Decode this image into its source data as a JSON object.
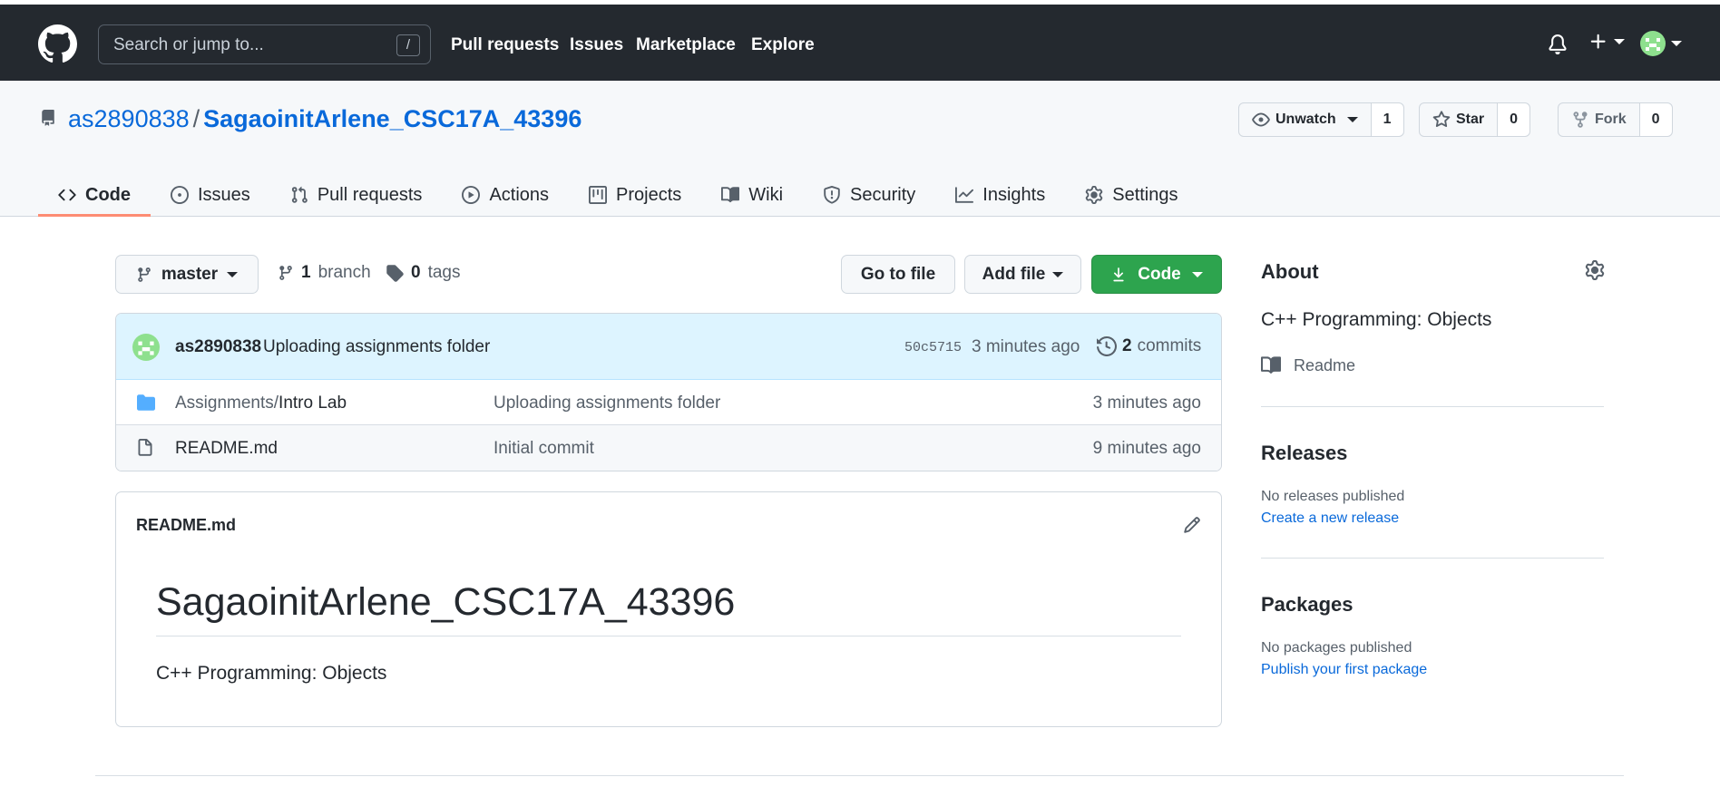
{
  "header": {
    "search_placeholder": "Search or jump to...",
    "search_shortcut": "/",
    "nav": [
      "Pull requests",
      "Issues",
      "Marketplace",
      "Explore"
    ]
  },
  "repo": {
    "owner": "as2890838",
    "separator": "/",
    "name": "SagaoinitArlene_CSC17A_43396",
    "watch_label": "Unwatch",
    "watch_count": "1",
    "star_label": "Star",
    "star_count": "0",
    "fork_label": "Fork",
    "fork_count": "0",
    "tabs": [
      {
        "label": "Code",
        "icon": "code-icon",
        "active": true
      },
      {
        "label": "Issues",
        "icon": "issue-icon"
      },
      {
        "label": "Pull requests",
        "icon": "pull-request-icon"
      },
      {
        "label": "Actions",
        "icon": "play-icon"
      },
      {
        "label": "Projects",
        "icon": "project-icon"
      },
      {
        "label": "Wiki",
        "icon": "book-icon"
      },
      {
        "label": "Security",
        "icon": "shield-icon"
      },
      {
        "label": "Insights",
        "icon": "graph-icon"
      },
      {
        "label": "Settings",
        "icon": "gear-icon"
      }
    ]
  },
  "toolbar": {
    "branch": "master",
    "branch_count": "1",
    "branch_label": "branch",
    "tag_count": "0",
    "tag_label": "tags",
    "go_to_file": "Go to file",
    "add_file": "Add file",
    "code": "Code"
  },
  "commit": {
    "author": "as2890838",
    "message": "Uploading assignments folder",
    "sha": "50c5715",
    "time": "3 minutes ago",
    "count": "2",
    "count_label": "commits"
  },
  "files": [
    {
      "type": "folder",
      "prefix": "Assignments/",
      "name": "Intro Lab",
      "message": "Uploading assignments folder",
      "time": "3 minutes ago"
    },
    {
      "type": "file",
      "prefix": "",
      "name": "README.md",
      "message": "Initial commit",
      "time": "9 minutes ago"
    }
  ],
  "readme": {
    "filename": "README.md",
    "heading": "SagaoinitArlene_CSC17A_43396",
    "body": "C++ Programming: Objects"
  },
  "sidebar": {
    "about_title": "About",
    "description": "C++ Programming: Objects",
    "readme_label": "Readme",
    "releases_title": "Releases",
    "releases_none": "No releases published",
    "releases_link": "Create a new release",
    "packages_title": "Packages",
    "packages_none": "No packages published",
    "packages_link": "Publish your first package"
  },
  "colors": {
    "header_bg": "#24292f",
    "link": "#0969da",
    "green_button": "#2da44e",
    "active_tab_underline": "#fd8c73",
    "commit_bar": "#ddf4ff",
    "folder_icon": "#54aeff"
  }
}
